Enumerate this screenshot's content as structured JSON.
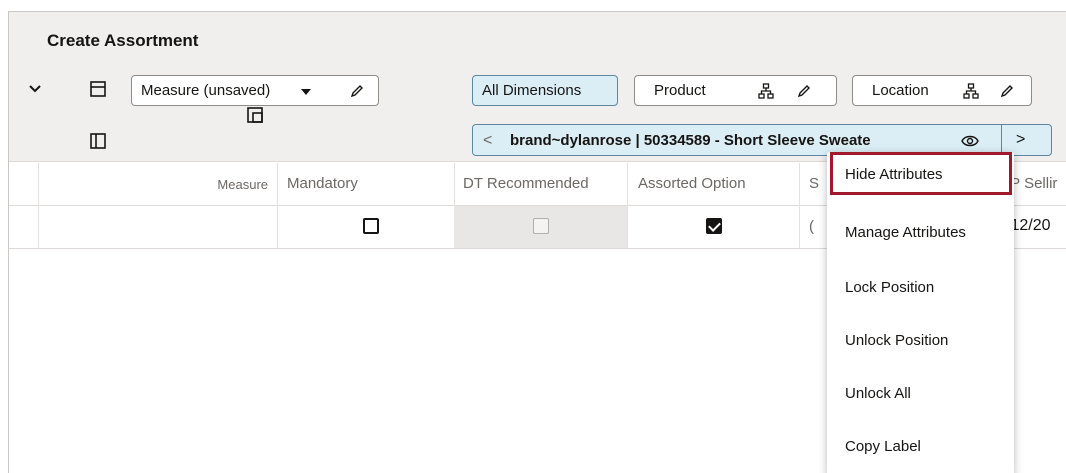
{
  "title": "Create Assortment",
  "toolbar": {
    "measure_select": "Measure (unsaved)",
    "all_dimensions": "All Dimensions",
    "product": "Product",
    "location": "Location",
    "pill_text": "brand~dylanrose | 50334589 - Short Sleeve Sweate",
    "pill_prev": "<",
    "pill_next": ">"
  },
  "grid": {
    "headers": [
      "Measure",
      "Mandatory",
      "DT Recommended",
      "Assorted Option",
      "S",
      "/P Sellir"
    ],
    "row1": {
      "mandatory": false,
      "dt_recommended": false,
      "assorted_option": true,
      "partial_date": "/12/20",
      "s_partial": "("
    }
  },
  "menu": {
    "items": [
      "Hide Attributes",
      "Manage Attributes",
      "Lock Position",
      "Unlock Position",
      "Unlock All",
      "Copy Label"
    ],
    "highlighted_index": 0
  },
  "icons": {
    "chevron": "chevron-down-icon",
    "layout_horizontal": "split-horizontal-icon",
    "layout_vertical": "split-vertical-icon",
    "pivot": "pivot-icon",
    "hierarchy": "hierarchy-icon",
    "edit": "pencil-icon",
    "eye": "eye-icon",
    "dropdown": "caret-down-icon"
  },
  "colors": {
    "accent_bg": "#dbeef6",
    "accent_border": "#5d87a1",
    "highlight_border": "#a1192d"
  }
}
